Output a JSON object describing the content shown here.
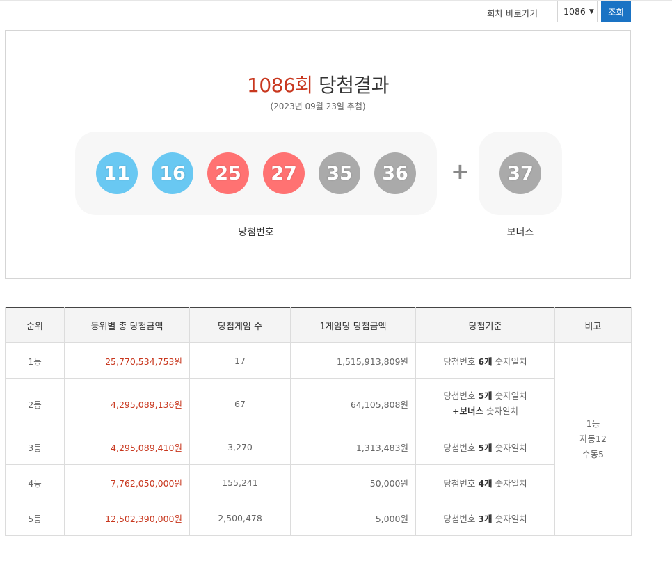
{
  "nav": {
    "label": "회차 바로가기",
    "selected_round": "1086",
    "search_button": "조회"
  },
  "result": {
    "round": "1086회",
    "title_suffix": "당첨결과",
    "date": "(2023년 09월 23일 추첨)",
    "numbers": [
      {
        "value": "11",
        "color": "#69c8f2"
      },
      {
        "value": "16",
        "color": "#69c8f2"
      },
      {
        "value": "25",
        "color": "#ff7272"
      },
      {
        "value": "27",
        "color": "#ff7272"
      },
      {
        "value": "35",
        "color": "#aaaaaa"
      },
      {
        "value": "36",
        "color": "#aaaaaa"
      }
    ],
    "plus": "+",
    "bonus": {
      "value": "37",
      "color": "#aaaaaa"
    },
    "numbers_caption": "당첨번호",
    "bonus_caption": "보너스"
  },
  "table": {
    "headers": [
      "순위",
      "등위별 총 당첨금액",
      "당첨게임 수",
      "1게임당 당첨금액",
      "당첨기준",
      "비고"
    ],
    "rows": [
      {
        "rank": "1등",
        "total": "25,770,534,753원",
        "winners": "17",
        "per_game": "1,515,913,809원",
        "criteria_pre": "당첨번호 ",
        "criteria_bold": "6개",
        "criteria_post": " 숫자일치",
        "criteria2_bold": "",
        "criteria2_post": ""
      },
      {
        "rank": "2등",
        "total": "4,295,089,136원",
        "winners": "67",
        "per_game": "64,105,808원",
        "criteria_pre": "당첨번호 ",
        "criteria_bold": "5개",
        "criteria_post": " 숫자일치",
        "criteria2_bold": "+보너스",
        "criteria2_post": " 숫자일치"
      },
      {
        "rank": "3등",
        "total": "4,295,089,410원",
        "winners": "3,270",
        "per_game": "1,313,483원",
        "criteria_pre": "당첨번호 ",
        "criteria_bold": "5개",
        "criteria_post": " 숫자일치",
        "criteria2_bold": "",
        "criteria2_post": ""
      },
      {
        "rank": "4등",
        "total": "7,762,050,000원",
        "winners": "155,241",
        "per_game": "50,000원",
        "criteria_pre": "당첨번호 ",
        "criteria_bold": "4개",
        "criteria_post": " 숫자일치",
        "criteria2_bold": "",
        "criteria2_post": ""
      },
      {
        "rank": "5등",
        "total": "12,502,390,000원",
        "winners": "2,500,478",
        "per_game": "5,000원",
        "criteria_pre": "당첨번호 ",
        "criteria_bold": "3개",
        "criteria_post": " 숫자일치",
        "criteria2_bold": "",
        "criteria2_post": ""
      }
    ],
    "note": {
      "line1": "1등",
      "line2": "자동12",
      "line3": "수동5"
    }
  }
}
